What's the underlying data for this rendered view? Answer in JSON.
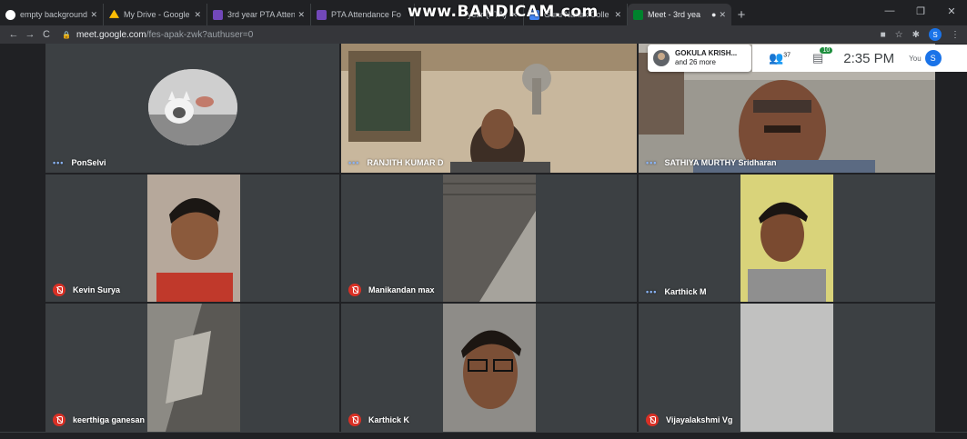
{
  "browser": {
    "tabs": [
      {
        "title": "empty background",
        "favicon_color": "#ffffff"
      },
      {
        "title": "My Drive - Google",
        "favicon_color": "#fbbc04"
      },
      {
        "title": "3rd year PTA Atten",
        "favicon_color": "#7248b9"
      },
      {
        "title": "PTA Attendance Fo",
        "favicon_color": "#7248b9"
      },
      {
        "title": "year (PTA) - G",
        "favicon_color": "#5f6368"
      },
      {
        "title": "Guru Nanak Colle",
        "favicon_color": "#4285f4"
      },
      {
        "title": "Meet - 3rd yea",
        "favicon_color": "#00832d",
        "active": true
      }
    ],
    "watermark": "www.BANDICAM.com",
    "url_host": "meet.google.com",
    "url_path": "/fes-apak-zwk?authuser=0",
    "profile_initial": "S"
  },
  "meet": {
    "presenter_name": "GOKULA KRISH...",
    "presenter_more": "and 26 more",
    "participants_count": "37",
    "chat_count": "10",
    "time": "2:35 PM",
    "you_label": "You",
    "you_initial": "S",
    "participants": [
      {
        "name": "PonSelvi",
        "status": "speaking"
      },
      {
        "name": "RANJITH KUMAR D",
        "status": "speaking"
      },
      {
        "name": "SATHIYA MURTHY Sridharan",
        "status": "speaking"
      },
      {
        "name": "Kevin Surya",
        "status": "muted"
      },
      {
        "name": "Manikandan max",
        "status": "muted"
      },
      {
        "name": "Karthick M",
        "status": "speaking"
      },
      {
        "name": "keerthiga ganesan",
        "status": "muted"
      },
      {
        "name": "Karthick K",
        "status": "muted"
      },
      {
        "name": "Vijayalakshmi Vg",
        "status": "muted"
      }
    ]
  }
}
